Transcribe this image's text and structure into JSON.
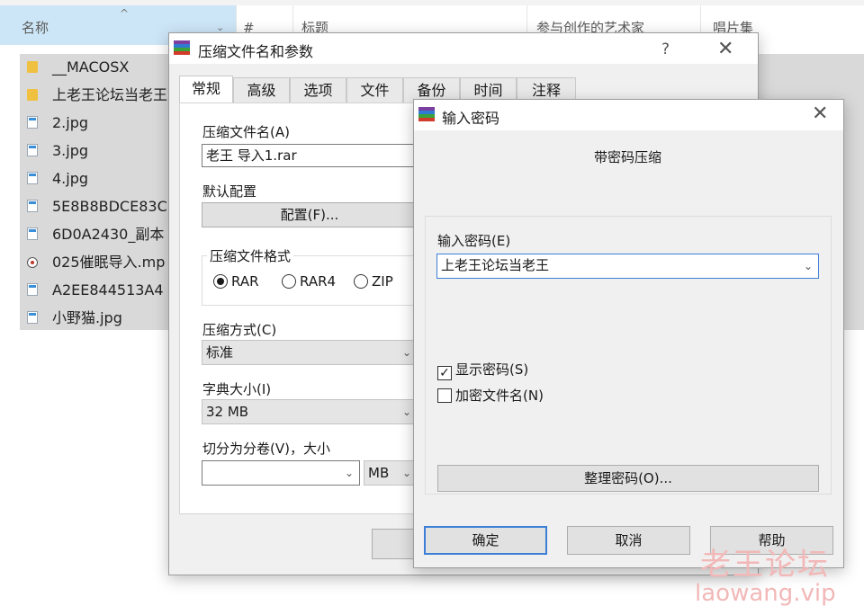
{
  "explorer": {
    "columns": [
      "名称",
      "#",
      "标题",
      "参与创作的艺术家",
      "唱片集"
    ],
    "sort_glyph": "^",
    "dropdown_glyph": "⌄",
    "files": [
      {
        "name": "__MACOSX",
        "icon": "folder-icon"
      },
      {
        "name": "上老王论坛当老王",
        "icon": "folder-icon"
      },
      {
        "name": "2.jpg",
        "icon": "image-file-icon"
      },
      {
        "name": "3.jpg",
        "icon": "image-file-icon"
      },
      {
        "name": "4.jpg",
        "icon": "image-file-icon"
      },
      {
        "name": "5E8B8BDCE83C",
        "icon": "image-file-icon"
      },
      {
        "name": "6D0A2430_副本",
        "icon": "image-file-icon"
      },
      {
        "name": "025催眠导入.mp",
        "icon": "media-file-icon"
      },
      {
        "name": "A2EE844513A4",
        "icon": "image-file-icon"
      },
      {
        "name": "小野猫.jpg",
        "icon": "image-file-icon"
      }
    ]
  },
  "archive_dialog": {
    "title": "压缩文件名和参数",
    "help_glyph": "?",
    "close_glyph": "✕",
    "tabs": [
      "常规",
      "高级",
      "选项",
      "文件",
      "备份",
      "时间",
      "注释"
    ],
    "archive_name_label": "压缩文件名(A)",
    "archive_name_value": "老王 导入1.rar",
    "default_profile_label": "默认配置",
    "profiles_button": "配置(F)...",
    "format_label": "压缩文件格式",
    "formats": [
      "RAR",
      "RAR4",
      "ZIP"
    ],
    "selected_format": "RAR",
    "method_label": "压缩方式(C)",
    "method_value": "标准",
    "dict_label": "字典大小(I)",
    "dict_value": "32 MB",
    "split_label": "切分为分卷(V)，大小",
    "split_value": "",
    "split_unit": "MB"
  },
  "password_dialog": {
    "title": "输入密码",
    "close_glyph": "✕",
    "subtitle": "带密码压缩",
    "password_label": "输入密码(E)",
    "password_value": "上老王论坛当老王",
    "show_password_label": "显示密码(S)",
    "show_password_checked": true,
    "encrypt_names_label": "加密文件名(N)",
    "encrypt_names_checked": false,
    "organize_button": "整理密码(O)...",
    "ok_button": "确定",
    "cancel_button": "取消",
    "help_button": "帮助",
    "check_glyph": "✓"
  },
  "watermark": {
    "line1": "老王论坛",
    "line2": "laowang.vip"
  }
}
